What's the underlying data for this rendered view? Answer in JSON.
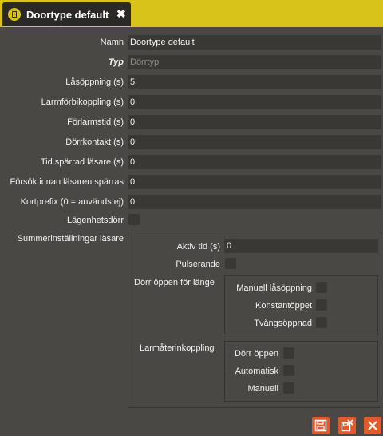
{
  "tab": {
    "title": "Doortype default",
    "icon": "door-icon",
    "close_glyph": "✖"
  },
  "form": {
    "namn": {
      "label": "Namn",
      "value": "Doortype default"
    },
    "typ": {
      "label": "Typ",
      "placeholder": "Dörrtyp"
    },
    "lasoppning": {
      "label": "Låsöppning (s)",
      "value": "5"
    },
    "larmforbikoppling": {
      "label": "Larmförbikoppling (s)",
      "value": "0"
    },
    "forlarmstid": {
      "label": "Förlarmstid (s)",
      "value": "0"
    },
    "dorrkontakt": {
      "label": "Dörrkontakt (s)",
      "value": "0"
    },
    "tid_sparrad": {
      "label": "Tid spärrad läsare (s)",
      "value": "0"
    },
    "forsok": {
      "label": "Försök innan läsaren spärras",
      "value": "0"
    },
    "kortprefix": {
      "label": "Kortprefix (0 = används ej)",
      "value": "0"
    },
    "lagenhetsdorr": {
      "label": "Lägenhetsdörr",
      "checked": false
    }
  },
  "summer": {
    "label": "Summerinställningar läsare",
    "aktiv_tid": {
      "label": "Aktiv tid (s)",
      "value": "0"
    },
    "pulserande": {
      "label": "Pulserande",
      "checked": false
    },
    "dorr_oppen_for_lange": {
      "label": "Dörr öppen för länge",
      "items": [
        {
          "label": "Manuell låsöppning",
          "checked": false
        },
        {
          "label": "Konstantöppet",
          "checked": false
        },
        {
          "label": "Tvångsöppnad",
          "checked": false
        }
      ]
    },
    "larmaterinkoppling": {
      "label": "Larmåterinkoppling",
      "items": [
        {
          "label": "Dörr öppen",
          "checked": false
        },
        {
          "label": "Automatisk",
          "checked": false
        },
        {
          "label": "Manuell",
          "checked": false
        }
      ]
    }
  },
  "actions": {
    "save": "save-icon",
    "save_and_close": "save-close-icon",
    "close": "close-icon"
  },
  "colors": {
    "accent": "#d8c31a",
    "action": "#e05a2b",
    "background": "#4a4845",
    "field": "#3a3835"
  }
}
